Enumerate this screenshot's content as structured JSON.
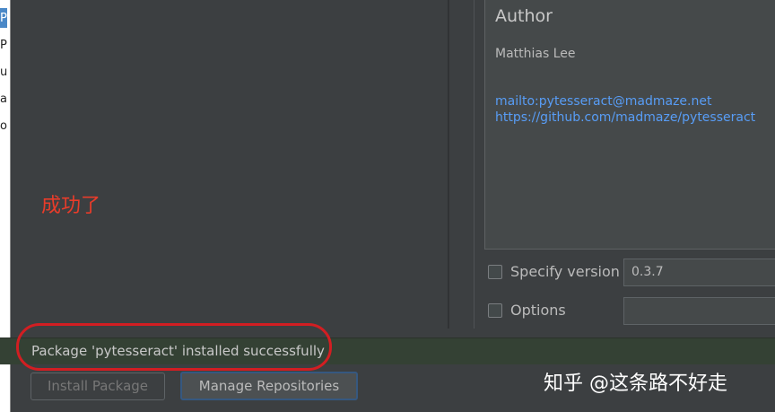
{
  "sidebar_fragments": [
    "P",
    "P",
    "u",
    "a",
    "o"
  ],
  "description": {
    "title": "Author",
    "author": "Matthias Lee",
    "links": [
      "mailto:pytesseract@madmaze.net",
      "https://github.com/madmaze/pytesseract"
    ]
  },
  "options": {
    "specify_version_label": "Specify version",
    "version_value": "0.3.7",
    "options_label": "Options",
    "options_value": ""
  },
  "status": {
    "message": "Package 'pytesseract' installed successfully",
    "color": "#344134"
  },
  "buttons": {
    "install_label": "Install Package",
    "manage_label": "Manage Repositories"
  },
  "annotation": {
    "text": "成功了",
    "color": "#e83c2a"
  },
  "watermark": "知乎 @这条路不好走"
}
